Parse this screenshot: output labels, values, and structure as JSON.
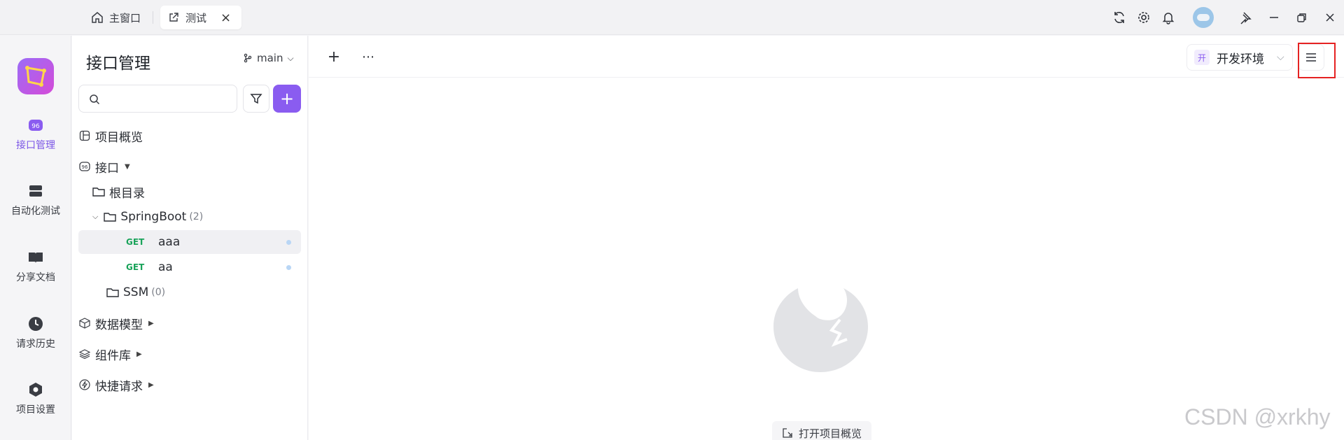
{
  "titlebar": {
    "home_tab": "主窗口",
    "active_tab": "测试"
  },
  "rail": {
    "items": [
      {
        "label": "接口管理"
      },
      {
        "label": "自动化测试"
      },
      {
        "label": "分享文档"
      },
      {
        "label": "请求历史"
      },
      {
        "label": "项目设置"
      }
    ]
  },
  "panel": {
    "title": "接口管理",
    "branch": "main",
    "search": {
      "placeholder": "",
      "value": ""
    },
    "tree": {
      "overview": "项目概览",
      "interfaces": "接口",
      "root_dir": "根目录",
      "folder1": {
        "name": "SpringBoot",
        "count": "(2)"
      },
      "requests": [
        {
          "method": "GET",
          "name": "aaa"
        },
        {
          "method": "GET",
          "name": "aa"
        }
      ],
      "folder2": {
        "name": "SSM",
        "count": "(0)"
      },
      "data_models": "数据模型",
      "components": "组件库",
      "quick_requests": "快捷请求"
    }
  },
  "main": {
    "env_badge": "开",
    "env_label": "开发环境",
    "open_overview": "打开项目概览"
  },
  "watermark": "CSDN @xrkhy",
  "colors": {
    "accent": "#8a5cf0",
    "get_method": "#1aa35a",
    "highlight": "#e52222"
  }
}
